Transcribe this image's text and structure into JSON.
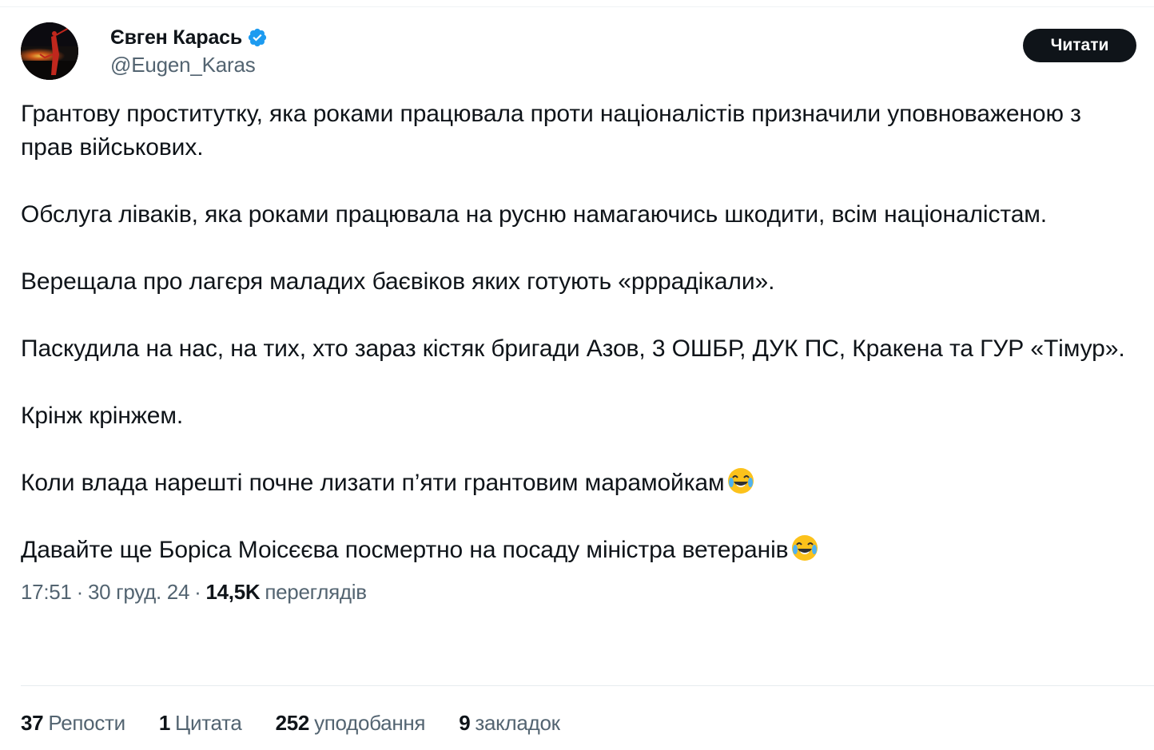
{
  "author": {
    "display_name": "Євген Карась",
    "handle": "@Eugen_Karas",
    "verified": true
  },
  "follow_button": {
    "label": "Читати"
  },
  "tweet": {
    "paragraphs": [
      "Грантову проститутку, яка роками працювала проти націоналістів призначили уповноваженою з прав військових.",
      "Обслуга ліваків, яка роками працювала на русню намагаючись шкодити, всім націоналістам.",
      "Верещала про лагєря маладих баєвіков яких готують «рррадікали».",
      "Паскудила на нас, на тих, хто зараз кістяк бригади Азов, 3 ОШБР, ДУК ПС, Кракена та ГУР «Тімур».",
      "Крінж крінжем.",
      "Коли влада нарешті почне лизати п’яти грантовим марамойкам",
      "Давайте ще Боріса Моісєєва посмертно на посаду міністра ветеранів"
    ]
  },
  "meta": {
    "time": "17:51",
    "separator": "·",
    "date": "30 груд. 24",
    "views_count": "14,5K",
    "views_label": "переглядів"
  },
  "stats": {
    "reposts": {
      "count": "37",
      "label": "Репости"
    },
    "quotes": {
      "count": "1",
      "label": "Цитата"
    },
    "likes": {
      "count": "252",
      "label": "уподобання"
    },
    "bookmarks": {
      "count": "9",
      "label": "закладок"
    }
  },
  "colors": {
    "text_primary": "#0f1419",
    "text_secondary": "#536471",
    "verified_blue": "#1d9bf0",
    "button_bg": "#0f1419"
  },
  "icons": {
    "verified": "verified-badge-icon",
    "emoji": "face-with-tears-of-joy-emoji"
  }
}
